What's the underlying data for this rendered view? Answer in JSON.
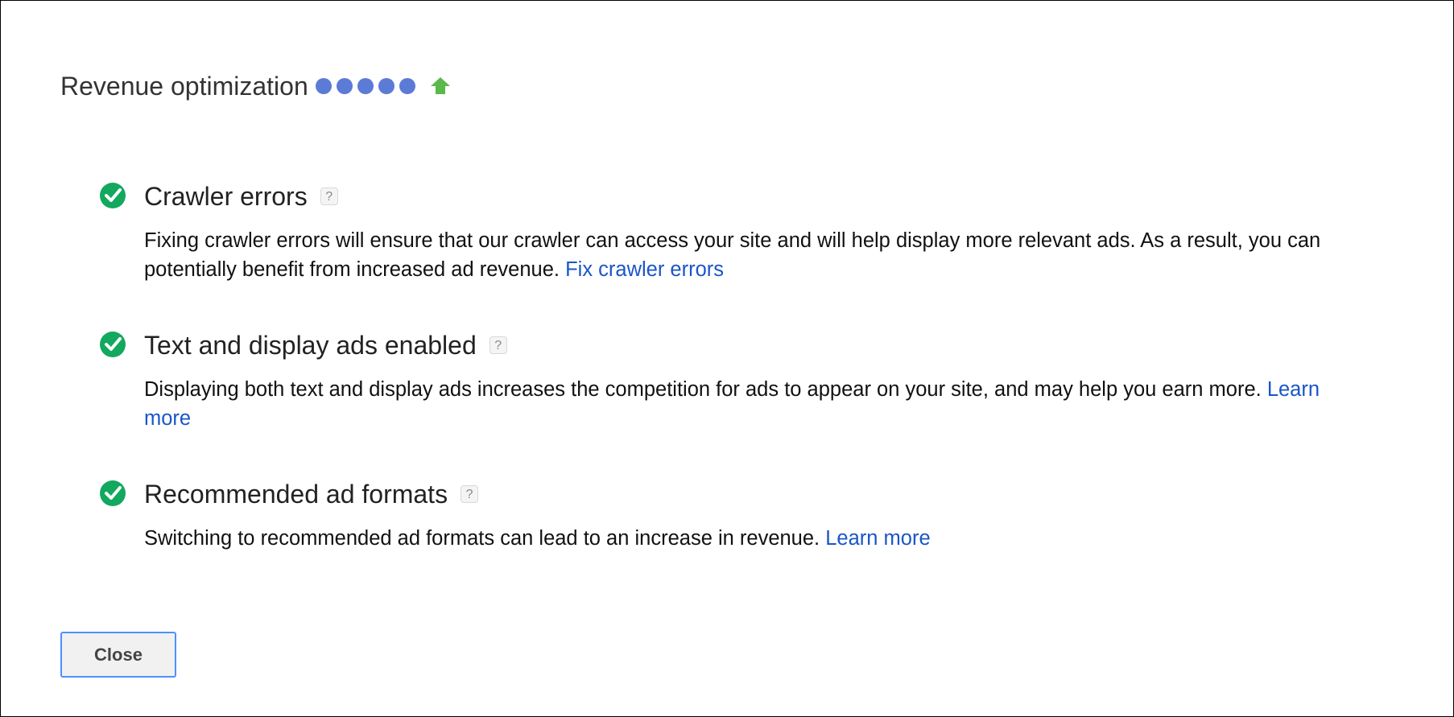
{
  "dialog": {
    "title": "Revenue optimization",
    "rating": {
      "value": 5,
      "max": 5,
      "filled_color": "#5c7bd6"
    },
    "trend": {
      "icon": "arrow-up-icon",
      "direction": "up",
      "color": "#5bb84a"
    }
  },
  "items": [
    {
      "status_icon": "check-circle-icon",
      "status": "ok",
      "title": "Crawler errors",
      "help_label": "?",
      "body": "Fixing crawler errors will ensure that our crawler can access your site and will help display more relevant ads. As a result, you can potentially benefit from increased ad revenue.",
      "link_label": "Fix crawler errors"
    },
    {
      "status_icon": "check-circle-icon",
      "status": "ok",
      "title": "Text and display ads enabled",
      "help_label": "?",
      "body": "Displaying both text and display ads increases the competition for ads to appear on your site, and may help you earn more.",
      "link_label": "Learn more"
    },
    {
      "status_icon": "check-circle-icon",
      "status": "ok",
      "title": "Recommended ad formats",
      "help_label": "?",
      "body": "Switching to recommended ad formats can lead to an increase in revenue.",
      "link_label": "Learn more"
    }
  ],
  "footer": {
    "close_label": "Close"
  },
  "colors": {
    "check_green": "#12a85e",
    "link_blue": "#1a55c9",
    "button_border": "#4d90fe"
  }
}
